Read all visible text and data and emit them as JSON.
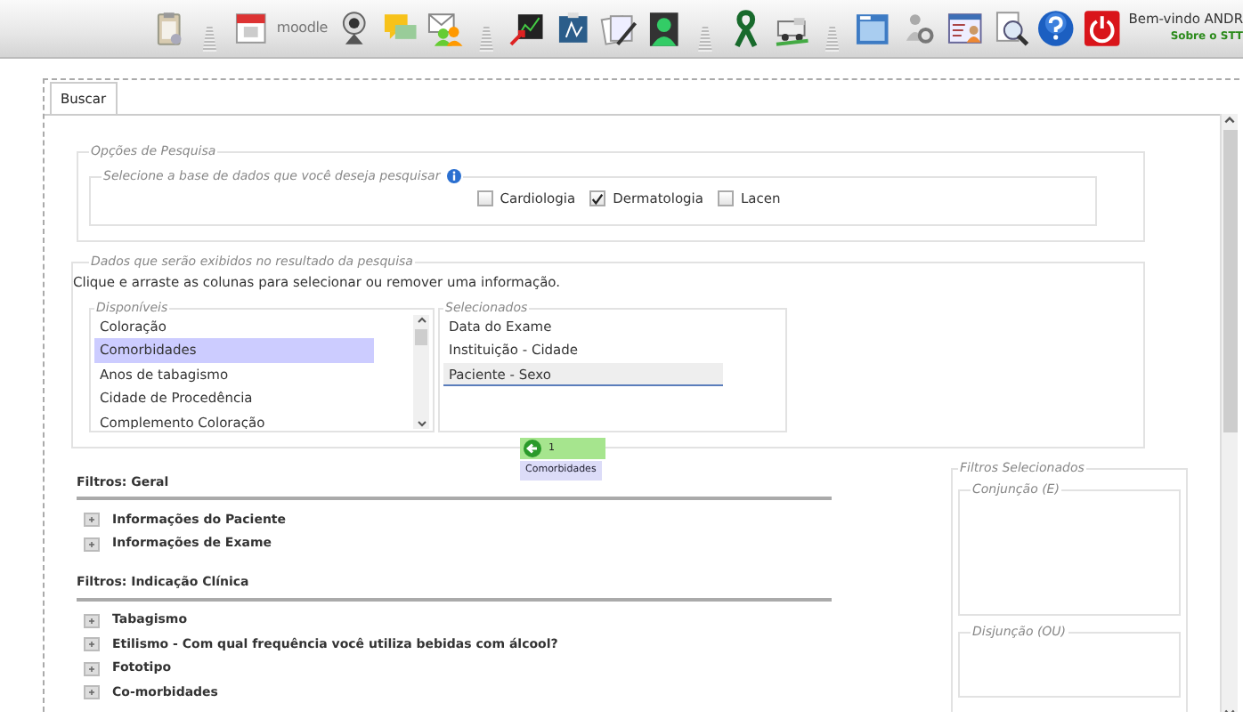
{
  "toolbar": [
    {
      "kind": "icon"
    },
    {
      "kind": "separator"
    },
    {
      "kind": "icon"
    },
    {
      "kind": "logo",
      "text": "moodle"
    },
    {
      "kind": "icon"
    },
    {
      "kind": "icon"
    },
    {
      "kind": "icon"
    },
    {
      "kind": "separator"
    },
    {
      "kind": "icon"
    },
    {
      "kind": "icon"
    },
    {
      "kind": "icon"
    },
    {
      "kind": "icon"
    },
    {
      "kind": "separator"
    },
    {
      "kind": "icon"
    },
    {
      "kind": "icon"
    },
    {
      "kind": "separator"
    },
    {
      "kind": "icon"
    },
    {
      "kind": "icon"
    },
    {
      "kind": "icon"
    },
    {
      "kind": "icon"
    },
    {
      "kind": "icon"
    },
    {
      "kind": "icon"
    }
  ],
  "user": {
    "greeting": "Bem-vindo ANDR",
    "about": "Sobre o STT"
  },
  "tabs": [
    {
      "label": "Buscar",
      "selected": true
    }
  ],
  "search_options": {
    "legend": "Opções de Pesquisa",
    "database": {
      "legend": "Selecione a base de dados que você deseja pesquisar",
      "options": [
        {
          "label": "Cardiologia",
          "checked": false
        },
        {
          "label": "Dermatologia",
          "checked": true
        },
        {
          "label": "Lacen",
          "checked": false
        }
      ]
    }
  },
  "result_fields": {
    "legend": "Dados que serão exibidos no resultado da pesquisa",
    "instruction": "Clique e arraste as colunas para selecionar ou remover uma informação.",
    "available": {
      "legend": "Disponíveis",
      "items": [
        {
          "label": "Coloração",
          "selected": false
        },
        {
          "label": "Comorbidades",
          "selected": true
        },
        {
          "label": "Anos de tabagismo",
          "selected": false
        },
        {
          "label": "Cidade de Procedência",
          "selected": false
        },
        {
          "label": "Complemento Coloração",
          "selected": false
        }
      ]
    },
    "chosen": {
      "legend": "Selecionados",
      "items": [
        {
          "label": "Data do Exame",
          "selected": false
        },
        {
          "label": "Instituição - Cidade",
          "selected": false
        },
        {
          "label": "Paciente - Sexo",
          "selected": true
        }
      ]
    },
    "drag_helper": {
      "count": "1",
      "label": "Comorbidades"
    }
  },
  "filter_groups": [
    {
      "title": "Filtros: Geral",
      "items": [
        {
          "label": "Informações do Paciente"
        },
        {
          "label": "Informações de Exame"
        }
      ]
    },
    {
      "title": "Filtros: Indicação Clínica",
      "items": [
        {
          "label": "Tabagismo"
        },
        {
          "label": "Etilismo - Com qual frequência você utiliza bebidas com álcool?"
        },
        {
          "label": "Fototipo"
        },
        {
          "label": "Co-morbidades"
        }
      ]
    }
  ],
  "selected_filters": {
    "legend": "Filtros Selecionados",
    "conjunction": {
      "legend": "Conjunção (E)"
    },
    "disjunction": {
      "legend": "Disjunção (OU)"
    }
  }
}
